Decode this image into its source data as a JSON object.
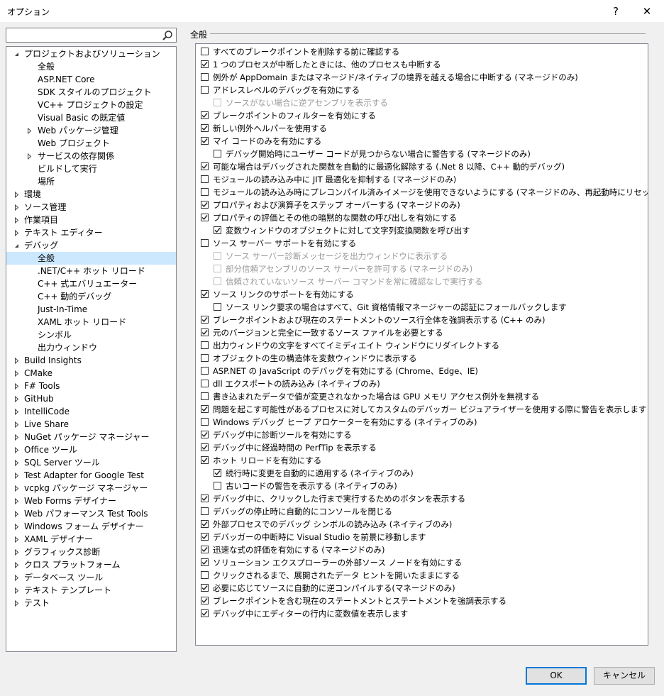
{
  "window": {
    "title": "オプション",
    "help": "?",
    "close": "✕"
  },
  "search": {
    "value": "",
    "placeholder": ""
  },
  "tree": [
    {
      "label": "プロジェクトおよびソリューション",
      "level": 0,
      "arrow": "down"
    },
    {
      "label": "全般",
      "level": 1
    },
    {
      "label": "ASP.NET Core",
      "level": 1
    },
    {
      "label": "SDK スタイルのプロジェクト",
      "level": 1
    },
    {
      "label": "VC++ プロジェクトの設定",
      "level": 1
    },
    {
      "label": "Visual Basic の既定値",
      "level": 1
    },
    {
      "label": "Web パッケージ管理",
      "level": 1,
      "arrow": "right"
    },
    {
      "label": "Web プロジェクト",
      "level": 1
    },
    {
      "label": "サービスの依存関係",
      "level": 1,
      "arrow": "right"
    },
    {
      "label": "ビルドして実行",
      "level": 1
    },
    {
      "label": "場所",
      "level": 1
    },
    {
      "label": "環境",
      "level": 0,
      "arrow": "right"
    },
    {
      "label": "ソース管理",
      "level": 0,
      "arrow": "right"
    },
    {
      "label": "作業項目",
      "level": 0,
      "arrow": "right"
    },
    {
      "label": "テキスト エディター",
      "level": 0,
      "arrow": "right"
    },
    {
      "label": "デバッグ",
      "level": 0,
      "arrow": "down"
    },
    {
      "label": "全般",
      "level": 1,
      "selected": true
    },
    {
      "label": ".NET/C++ ホット リロード",
      "level": 1
    },
    {
      "label": "C++ 式エバリュエーター",
      "level": 1
    },
    {
      "label": "C++ 動的デバッグ",
      "level": 1
    },
    {
      "label": "Just-In-Time",
      "level": 1
    },
    {
      "label": "XAML ホット リロード",
      "level": 1
    },
    {
      "label": "シンボル",
      "level": 1
    },
    {
      "label": "出力ウィンドウ",
      "level": 1
    },
    {
      "label": "Build Insights",
      "level": 0,
      "arrow": "right"
    },
    {
      "label": "CMake",
      "level": 0,
      "arrow": "right"
    },
    {
      "label": "F# Tools",
      "level": 0,
      "arrow": "right"
    },
    {
      "label": "GitHub",
      "level": 0,
      "arrow": "right"
    },
    {
      "label": "IntelliCode",
      "level": 0,
      "arrow": "right"
    },
    {
      "label": "Live Share",
      "level": 0,
      "arrow": "right"
    },
    {
      "label": "NuGet パッケージ マネージャー",
      "level": 0,
      "arrow": "right"
    },
    {
      "label": "Office ツール",
      "level": 0,
      "arrow": "right"
    },
    {
      "label": "SQL Server ツール",
      "level": 0,
      "arrow": "right"
    },
    {
      "label": "Test Adapter for Google Test",
      "level": 0,
      "arrow": "right"
    },
    {
      "label": "vcpkg パッケージ マネージャー",
      "level": 0,
      "arrow": "right"
    },
    {
      "label": "Web Forms デザイナー",
      "level": 0,
      "arrow": "right"
    },
    {
      "label": "Web パフォーマンス Test Tools",
      "level": 0,
      "arrow": "right"
    },
    {
      "label": "Windows フォーム デザイナー",
      "level": 0,
      "arrow": "right"
    },
    {
      "label": "XAML デザイナー",
      "level": 0,
      "arrow": "right"
    },
    {
      "label": "グラフィックス診断",
      "level": 0,
      "arrow": "right"
    },
    {
      "label": "クロス プラットフォーム",
      "level": 0,
      "arrow": "right"
    },
    {
      "label": "データベース ツール",
      "level": 0,
      "arrow": "right"
    },
    {
      "label": "テキスト テンプレート",
      "level": 0,
      "arrow": "right"
    },
    {
      "label": "テスト",
      "level": 0,
      "arrow": "right"
    }
  ],
  "section": {
    "title": "全般"
  },
  "options": [
    {
      "label": "すべてのブレークポイントを削除する前に確認する",
      "checked": false,
      "level": 0
    },
    {
      "label": "1 つのプロセスが中断したときには、他のプロセスも中断する",
      "checked": true,
      "level": 0
    },
    {
      "label": "例外が AppDomain またはマネージド/ネイティブの境界を越える場合に中断する (マネージドのみ)",
      "checked": false,
      "level": 0
    },
    {
      "label": "アドレスレベルのデバッグを有効にする",
      "checked": false,
      "level": 0
    },
    {
      "label": "ソースがない場合に逆アセンブリを表示する",
      "checked": false,
      "level": 1,
      "disabled": true
    },
    {
      "label": "ブレークポイントのフィルターを有効にする",
      "checked": true,
      "level": 0
    },
    {
      "label": "新しい例外ヘルパーを使用する",
      "checked": true,
      "level": 0
    },
    {
      "label": "マイ コードのみを有効にする",
      "checked": true,
      "level": 0
    },
    {
      "label": "デバッグ開始時にユーザー コードが見つからない場合に警告する (マネージドのみ)",
      "checked": false,
      "level": 1
    },
    {
      "label": "可能な場合はデバッグされた関数を自動的に最適化解除する (.Net 8 以降、C++ 動的デバッグ)",
      "checked": true,
      "level": 0
    },
    {
      "label": "モジュールの読み込み中に JIT 最適化を抑制する (マネージドのみ)",
      "checked": false,
      "level": 0
    },
    {
      "label": "モジュールの読み込み時にプレコンパイル済みイメージを使用できないようにする (マネージドのみ、再起動時にリセット)",
      "checked": false,
      "level": 0
    },
    {
      "label": "プロパティおよび演算子をステップ オーバーする (マネージドのみ)",
      "checked": true,
      "level": 0
    },
    {
      "label": "プロパティの評価とその他の暗黙的な関数の呼び出しを有効にする",
      "checked": true,
      "level": 0
    },
    {
      "label": "変数ウィンドウのオブジェクトに対して文字列変換関数を呼び出す",
      "checked": true,
      "level": 1
    },
    {
      "label": "ソース サーバー サポートを有効にする",
      "checked": false,
      "level": 0
    },
    {
      "label": "ソース サーバー診断メッセージを出力ウィンドウに表示する",
      "checked": false,
      "level": 1,
      "disabled": true
    },
    {
      "label": "部分信頼アセンブリのソース サーバーを許可する (マネージドのみ)",
      "checked": false,
      "level": 1,
      "disabled": true
    },
    {
      "label": "信頼されていないソース サーバー コマンドを常に確認なしで実行する",
      "checked": false,
      "level": 1,
      "disabled": true
    },
    {
      "label": "ソース リンクのサポートを有効にする",
      "checked": true,
      "level": 0
    },
    {
      "label": "ソース リンク要求の場合はすべて、Git 資格情報マネージャーの認証にフォールバックします",
      "checked": false,
      "level": 1
    },
    {
      "label": "ブレークポイントおよび現在のステートメントのソース行全体を強調表示する (C++ のみ)",
      "checked": true,
      "level": 0
    },
    {
      "label": "元のバージョンと完全に一致するソース ファイルを必要とする",
      "checked": true,
      "level": 0
    },
    {
      "label": "出力ウィンドウの文字をすべてイミディエイト ウィンドウにリダイレクトする",
      "checked": false,
      "level": 0
    },
    {
      "label": "オブジェクトの生の構造体を変数ウィンドウに表示する",
      "checked": false,
      "level": 0
    },
    {
      "label": "ASP.NET の JavaScript のデバッグを有効にする (Chrome、Edge、IE)",
      "checked": false,
      "level": 0
    },
    {
      "label": "dll エクスポートの読み込み (ネイティブのみ)",
      "checked": false,
      "level": 0
    },
    {
      "label": "書き込まれたデータで値が変更されなかった場合は GPU メモリ アクセス例外を無視する",
      "checked": false,
      "level": 0
    },
    {
      "label": "問題を起こす可能性があるプロセスに対してカスタムのデバッガー ビジュアライザーを使用する際に警告を表示します (マネージドのみ)",
      "checked": true,
      "level": 0
    },
    {
      "label": "Windows デバッグ ヒープ アロケーターを有効にする (ネイティブのみ)",
      "checked": false,
      "level": 0
    },
    {
      "label": "デバッグ中に診断ツールを有効にする",
      "checked": true,
      "level": 0
    },
    {
      "label": "デバッグ中に経過時間の PerfTip を表示する",
      "checked": true,
      "level": 0
    },
    {
      "label": "ホット リロードを有効にする",
      "checked": true,
      "level": 0
    },
    {
      "label": "続行時に変更を自動的に適用する (ネイティブのみ)",
      "checked": true,
      "level": 1
    },
    {
      "label": "古いコードの警告を表示する (ネイティブのみ)",
      "checked": false,
      "level": 1
    },
    {
      "label": "デバッグ中に、クリックした行まで実行するためのボタンを表示する",
      "checked": true,
      "level": 0
    },
    {
      "label": "デバッグの停止時に自動的にコンソールを閉じる",
      "checked": false,
      "level": 0
    },
    {
      "label": "外部プロセスでのデバッグ シンボルの読み込み (ネイティブのみ)",
      "checked": true,
      "level": 0
    },
    {
      "label": "デバッガーの中断時に Visual Studio を前景に移動します",
      "checked": true,
      "level": 0
    },
    {
      "label": "迅速な式の評価を有効にする (マネージドのみ)",
      "checked": true,
      "level": 0
    },
    {
      "label": "ソリューション エクスプローラーの外部ソース ノードを有効にする",
      "checked": true,
      "level": 0
    },
    {
      "label": "クリックされるまで、展開されたデータ ヒントを開いたままにする",
      "checked": false,
      "level": 0
    },
    {
      "label": "必要に応じてソースに自動的に逆コンパイルする(マネージドのみ)",
      "checked": true,
      "level": 0
    },
    {
      "label": "ブレークポイントを含む現在のステートメントとステートメントを強調表示する",
      "checked": true,
      "level": 0
    },
    {
      "label": "デバッグ中にエディターの行内に変数値を表示します",
      "checked": true,
      "level": 0
    }
  ],
  "buttons": {
    "ok": "OK",
    "cancel": "キャンセル"
  },
  "colors": {
    "selection": "#cce8ff",
    "accent": "#0078d7"
  }
}
